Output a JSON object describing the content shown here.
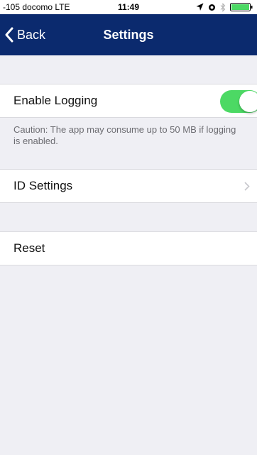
{
  "status_bar": {
    "carrier": "-105 docomo  LTE",
    "time": "11:49",
    "icons": [
      "location-icon",
      "alarm-icon",
      "bluetooth-icon",
      "battery-icon"
    ]
  },
  "nav": {
    "back_label": "Back",
    "title": "Settings",
    "bar_color": "#0b2a6e"
  },
  "settings": {
    "enable_logging": {
      "label": "Enable Logging",
      "enabled": true,
      "toggle_color": "#4cd964"
    },
    "caution_text": "Caution: The app may consume up to 50 MB if logging is enabled.",
    "id_settings_label": "ID Settings",
    "reset_label": "Reset"
  }
}
